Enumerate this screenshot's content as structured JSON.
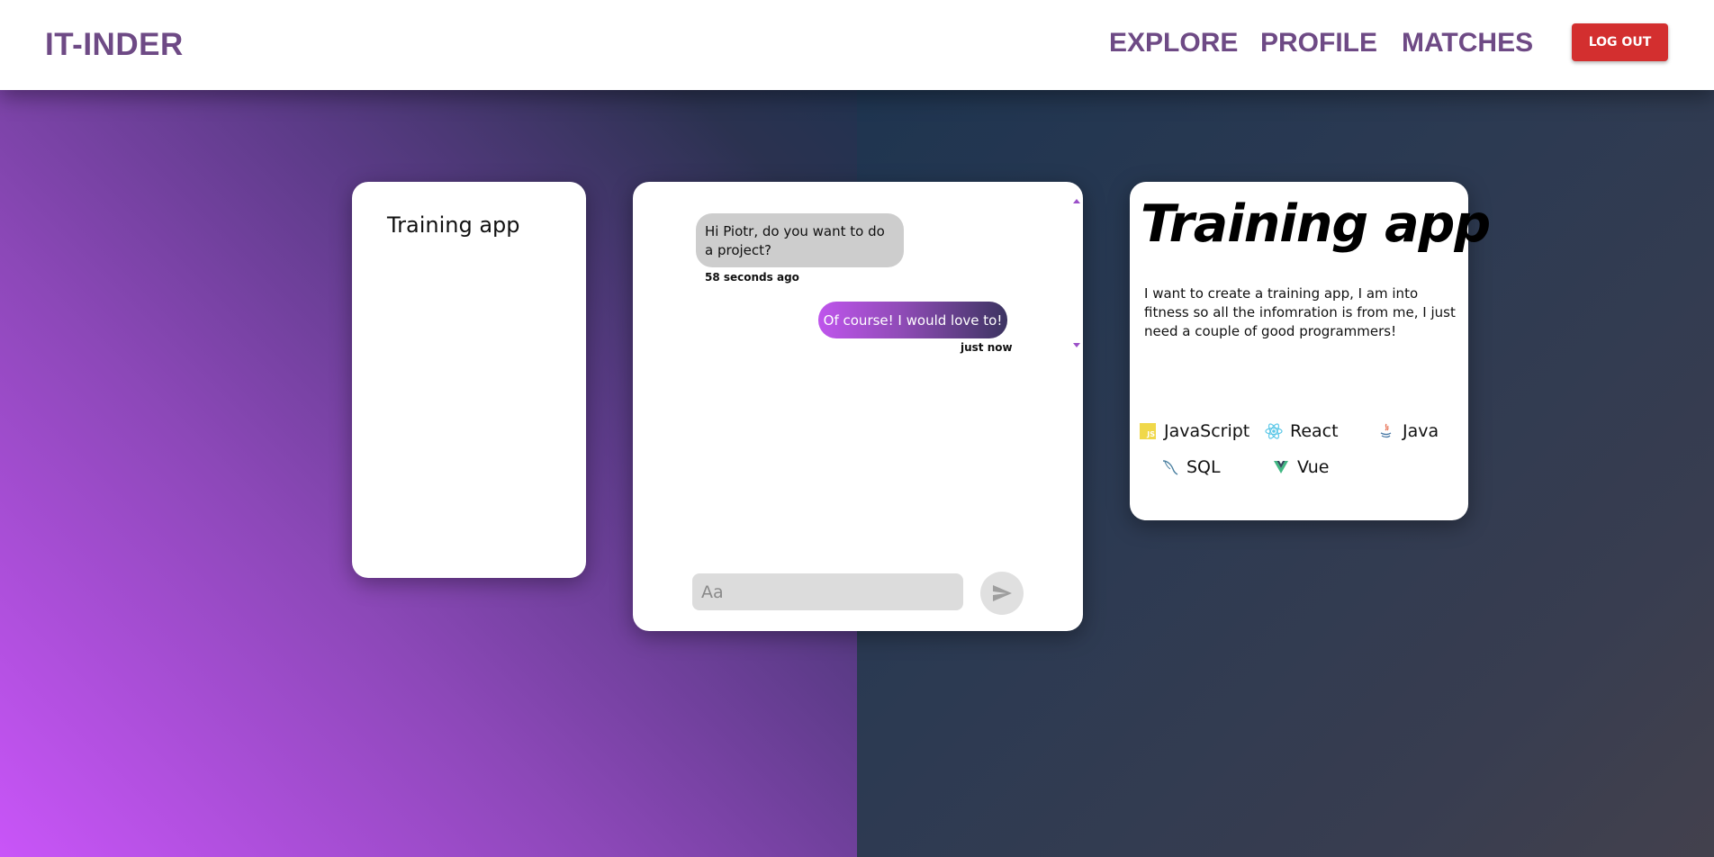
{
  "header": {
    "logo": "IT-INDER",
    "nav": {
      "explore": "EXPLORE",
      "profile": "PROFILE",
      "matches": "MATCHES"
    },
    "logout_label": "LOG OUT"
  },
  "matches_list": {
    "items": [
      {
        "label": "Training app"
      }
    ]
  },
  "chat": {
    "messages": [
      {
        "direction": "incoming",
        "text": "Hi Piotr, do you want to do a project?",
        "time": "58 seconds ago"
      },
      {
        "direction": "outgoing",
        "text": "Of course! I would love to!",
        "time": "just now"
      }
    ],
    "input": {
      "placeholder": "Aa",
      "value": ""
    },
    "send_icon": "send-icon"
  },
  "project": {
    "title": "Training app",
    "description": "I want to create a training app, I am into fitness so all the infomration is from me, I just need a couple of good programmers!",
    "technologies": [
      {
        "name": "JavaScript",
        "icon": "javascript-icon"
      },
      {
        "name": "React",
        "icon": "react-icon"
      },
      {
        "name": "Java",
        "icon": "java-icon"
      },
      {
        "name": "SQL",
        "icon": "sql-icon"
      },
      {
        "name": "Vue",
        "icon": "vue-icon"
      }
    ]
  },
  "colors": {
    "brand": "#6e4a85",
    "logout": "#d32f2f",
    "gradient_start": "#c955f8",
    "gradient_end": "#3c3461"
  }
}
